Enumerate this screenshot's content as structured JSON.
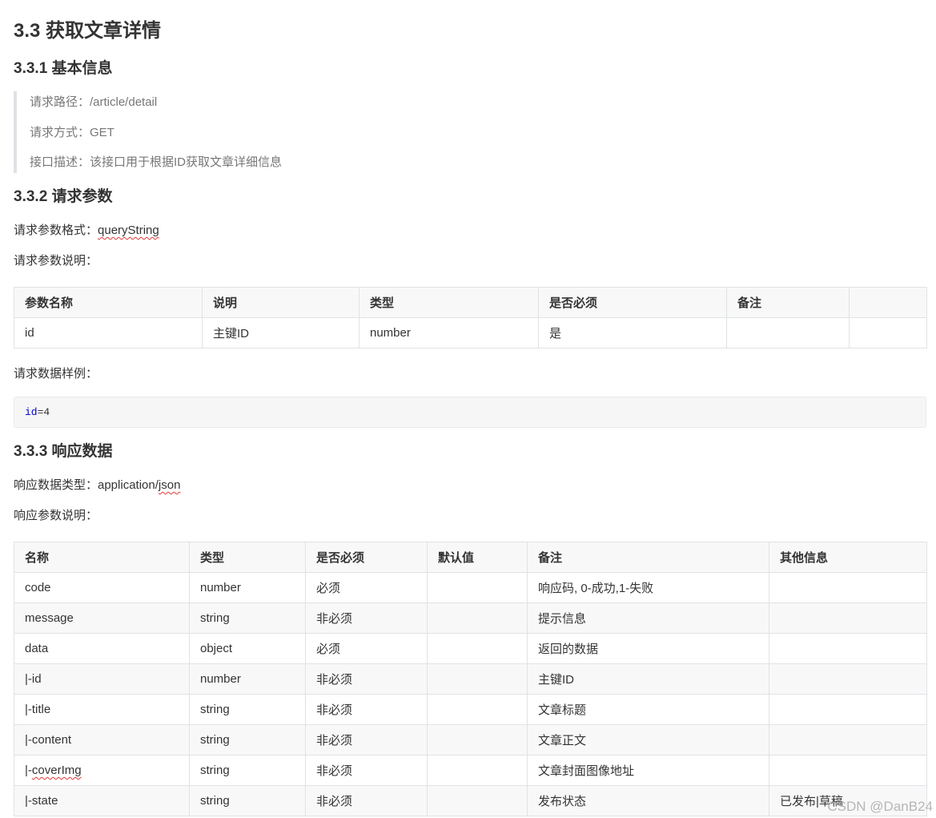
{
  "title": "3.3 获取文章详情",
  "section_basic": {
    "heading": "3.3.1 基本信息",
    "path": "请求路径：/article/detail",
    "method": "请求方式：GET",
    "desc": "接口描述：该接口用于根据ID获取文章详细信息"
  },
  "section_params": {
    "heading": "3.3.2 请求参数",
    "format_label": "请求参数格式：",
    "format_value": "queryString",
    "explain": "请求参数说明：",
    "table": {
      "headers": [
        "参数名称",
        "说明",
        "类型",
        "是否必须",
        "备注",
        ""
      ],
      "rows": [
        [
          "id",
          "主键ID",
          "number",
          "是",
          "",
          ""
        ]
      ]
    },
    "sample_label": "请求数据样例：",
    "sample_key": "id",
    "sample_rest": "=4"
  },
  "section_response": {
    "heading": "3.3.3 响应数据",
    "type_label": "响应数据类型：application/",
    "type_value": "json",
    "explain": "响应参数说明：",
    "table": {
      "headers": [
        "名称",
        "类型",
        "是否必须",
        "默认值",
        "备注",
        "其他信息"
      ],
      "rows": [
        [
          "code",
          "number",
          "必须",
          "",
          "响应码, 0-成功,1-失败",
          ""
        ],
        [
          "message",
          "string",
          "非必须",
          "",
          "提示信息",
          ""
        ],
        [
          "data",
          "object",
          "必须",
          "",
          "返回的数据",
          ""
        ],
        [
          "|-id",
          "number",
          "非必须",
          "",
          "主键ID",
          ""
        ],
        [
          "|-title",
          "string",
          "非必须",
          "",
          "文章标题",
          ""
        ],
        [
          "|-content",
          "string",
          "非必须",
          "",
          "文章正文",
          ""
        ],
        [
          "|-coverImg",
          "string",
          "非必须",
          "",
          "文章封面图像地址",
          ""
        ],
        [
          "|-state",
          "string",
          "非必须",
          "",
          "发布状态",
          "已发布|草稿"
        ]
      ]
    }
  },
  "watermark": "CSDN @DanB24"
}
